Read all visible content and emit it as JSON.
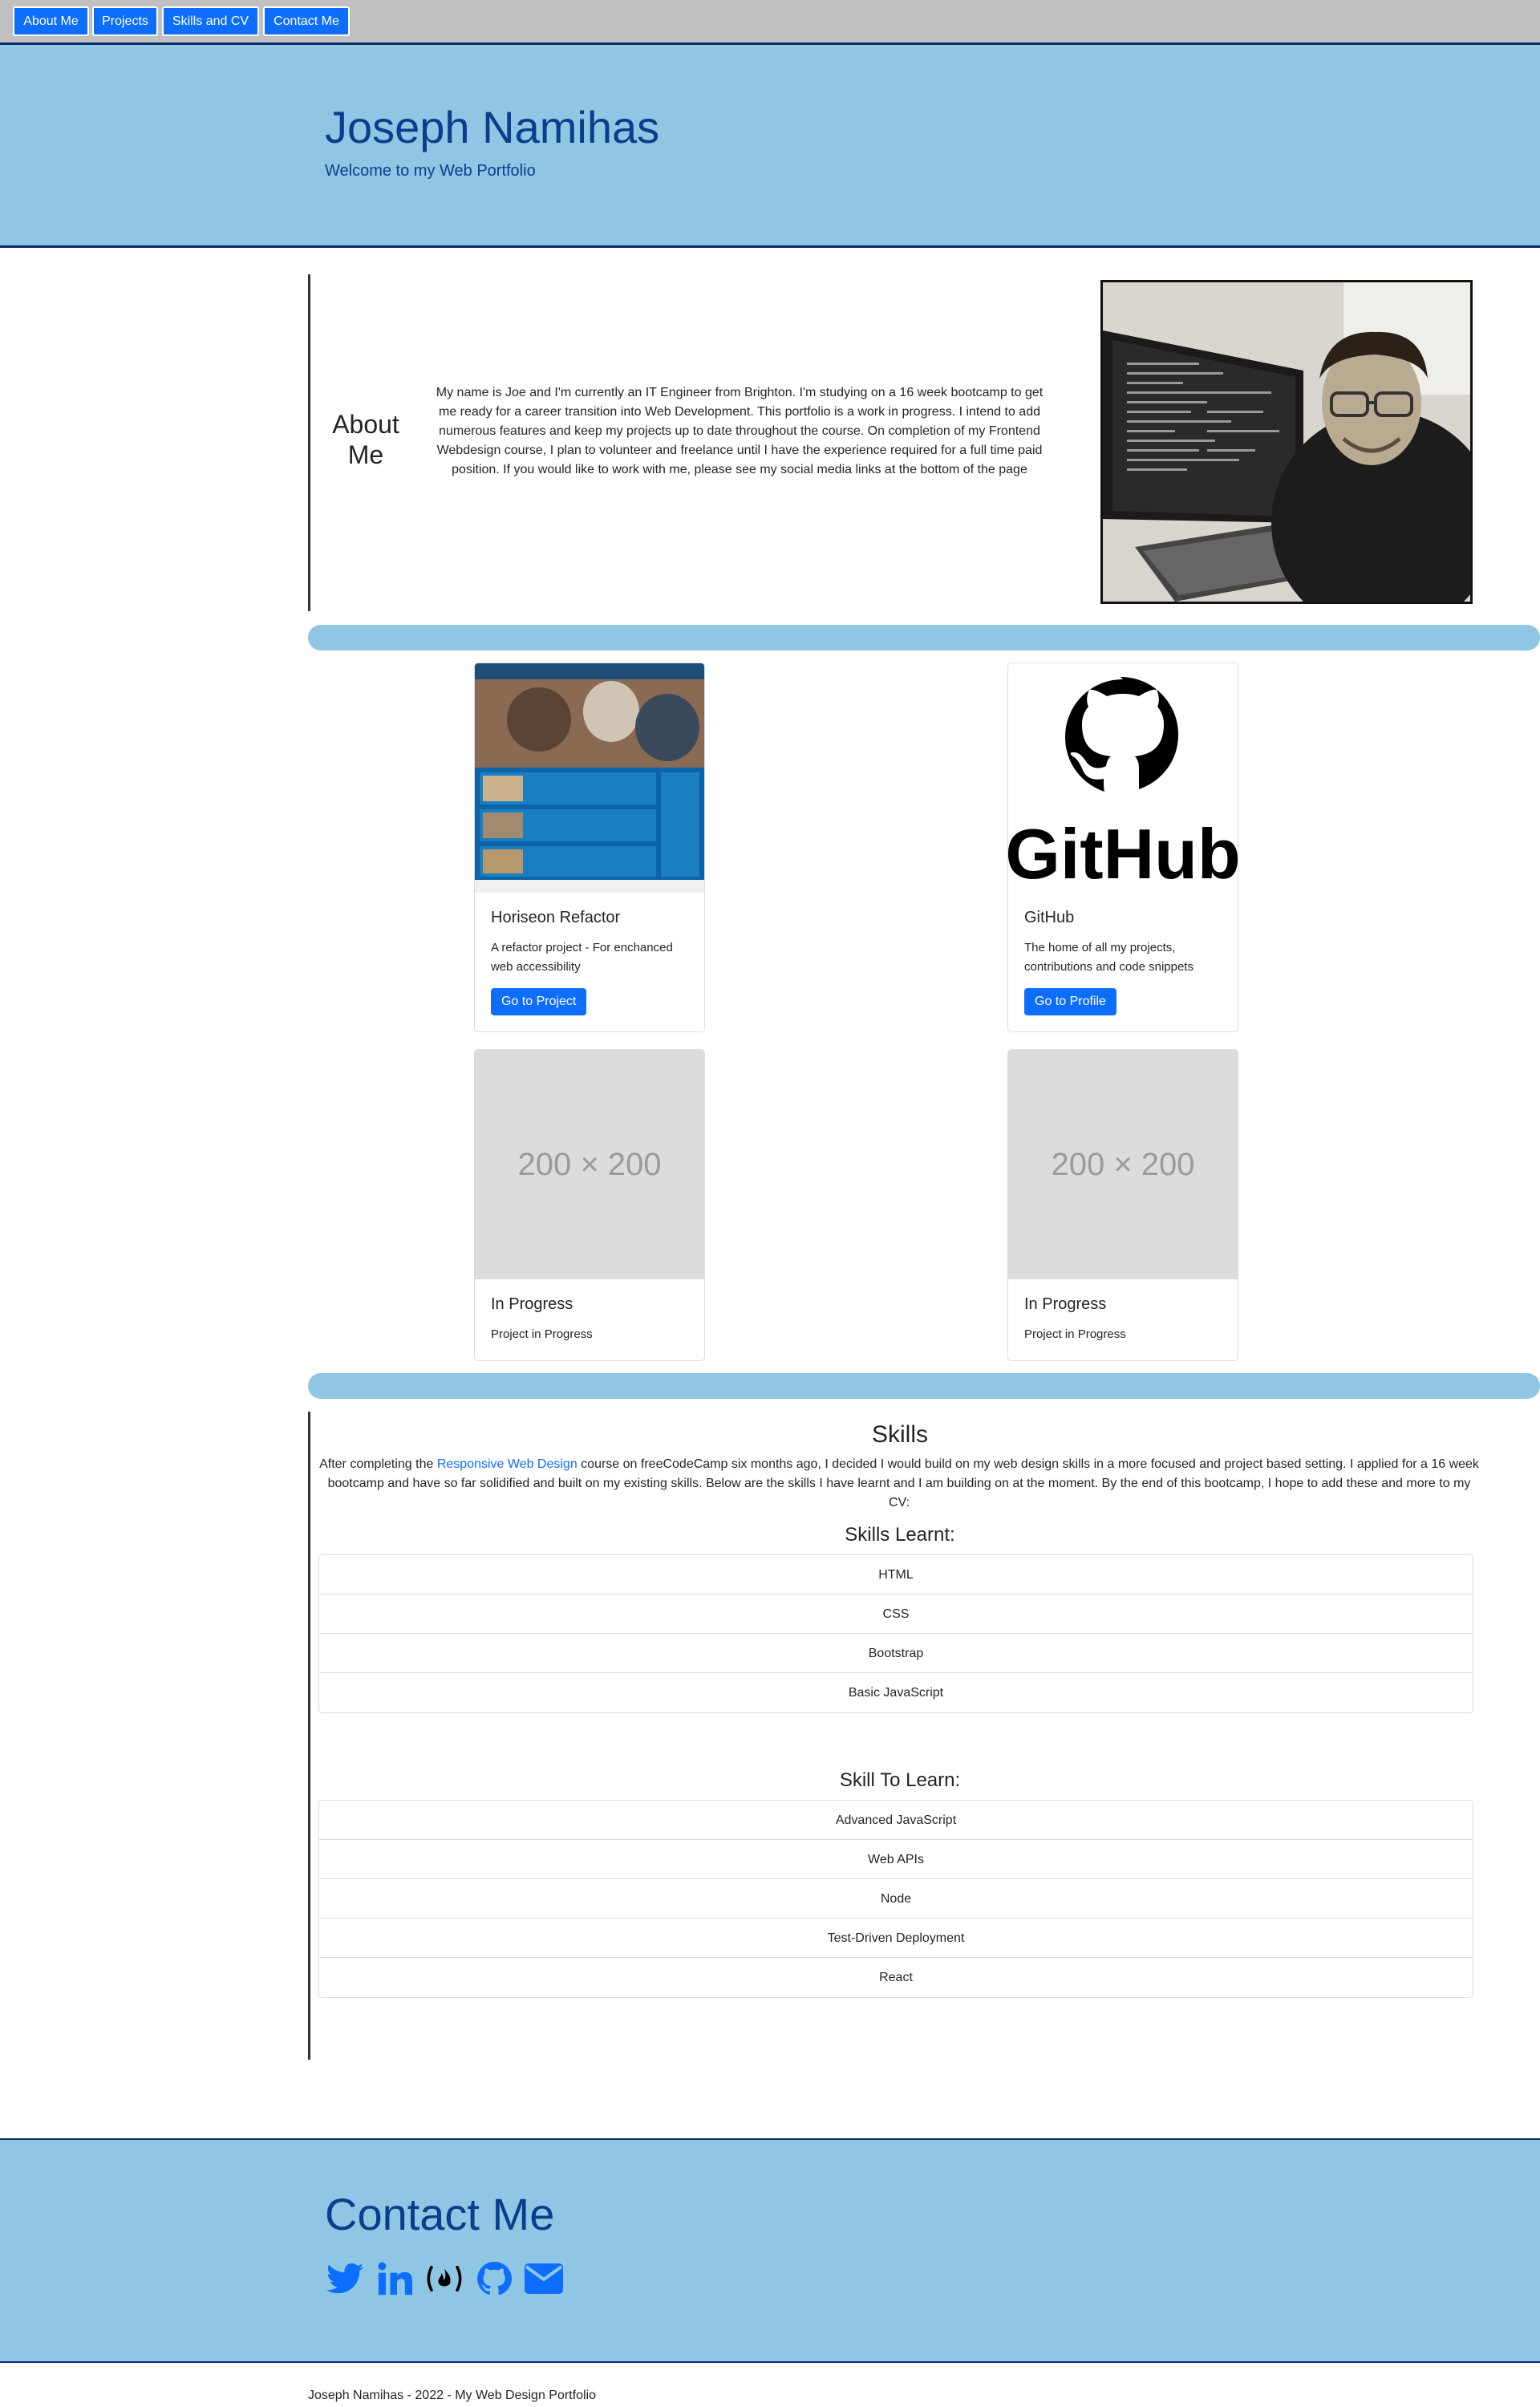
{
  "nav": {
    "items": [
      "About Me",
      "Projects",
      "Skills and CV",
      "Contact Me"
    ]
  },
  "header": {
    "title": "Joseph Namihas",
    "subtitle": "Welcome to my Web Portfolio"
  },
  "about": {
    "title": "About Me",
    "text": "My name is Joe and I'm currently an IT Engineer from Brighton. I'm studying on a 16 week bootcamp to get me ready for a career transition into Web Development. This portfolio is a work in progress. I intend to add numerous features and keep my projects up to date throughout the course. On completion of my Frontend Webdesign course, I plan to volunteer and freelance until I have the experience required for a full time paid position. If you would like to work with me, please see my social media links at the bottom of the page"
  },
  "projects": [
    {
      "title": "Horiseon Refactor",
      "text": "A refactor project - For enchanced web accessibility",
      "button": "Go to Project"
    },
    {
      "title": "GitHub",
      "text": "The home of all my projects, contributions and code snippets",
      "button": "Go to Profile",
      "logo_text": "GitHub"
    },
    {
      "title": "In Progress",
      "text": "Project in Progress",
      "placeholder": "200 × 200"
    },
    {
      "title": "In Progress",
      "text": "Project in Progress",
      "placeholder": "200 × 200"
    }
  ],
  "skills": {
    "title": "Skills",
    "intro_before": "After completing the ",
    "intro_link": "Responsive Web Design",
    "intro_after": " course on freeCodeCamp six months ago, I decided I would build on my web design skills in a more focused and project based setting. I applied for a 16 week bootcamp and have so far solidified and built on my existing skills. Below are the skills I have learnt and I am building on at the moment. By the end of this bootcamp, I hope to add these and more to my CV:",
    "learnt_title": "Skills Learnt:",
    "learnt": [
      "HTML",
      "CSS",
      "Bootstrap",
      "Basic JavaScript"
    ],
    "to_learn_title": "Skill To Learn:",
    "to_learn": [
      "Advanced JavaScript",
      "Web APIs",
      "Node",
      "Test-Driven Deployment",
      "React"
    ]
  },
  "contact": {
    "title": "Contact Me",
    "icons": [
      "twitter-icon",
      "linkedin-icon",
      "freecodecamp-icon",
      "github-icon",
      "email-icon"
    ]
  },
  "footer": {
    "text": "Joseph Namihas - 2022 - My Web Design Portfolio"
  },
  "colors": {
    "accent": "#0d6efd",
    "band": "#8ec6e4",
    "heading": "#0b3d8c"
  }
}
